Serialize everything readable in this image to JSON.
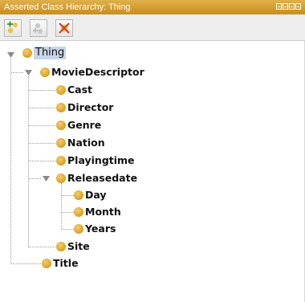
{
  "window": {
    "title": "Asserted Class Hierarchy: Thing"
  },
  "toolbar": {
    "buttons": [
      {
        "icon": "add-subclass-icon"
      },
      {
        "icon": "add-sibling-class-icon"
      },
      {
        "icon": "delete-class-icon"
      }
    ]
  },
  "tree": {
    "root": "Thing",
    "nodes": {
      "thing": "Thing",
      "movie_descriptor": "MovieDescriptor",
      "cast": "Cast",
      "director": "Director",
      "genre": "Genre",
      "nation": "Nation",
      "playingtime": "Playingtime",
      "releasedate": "Releasedate",
      "day": "Day",
      "month": "Month",
      "years": "Years",
      "site": "Site",
      "title": "Title"
    }
  },
  "colors": {
    "title_bar": "#d9a53a",
    "class_dot": "#e0a92f",
    "selection": "#c7d6ea"
  }
}
